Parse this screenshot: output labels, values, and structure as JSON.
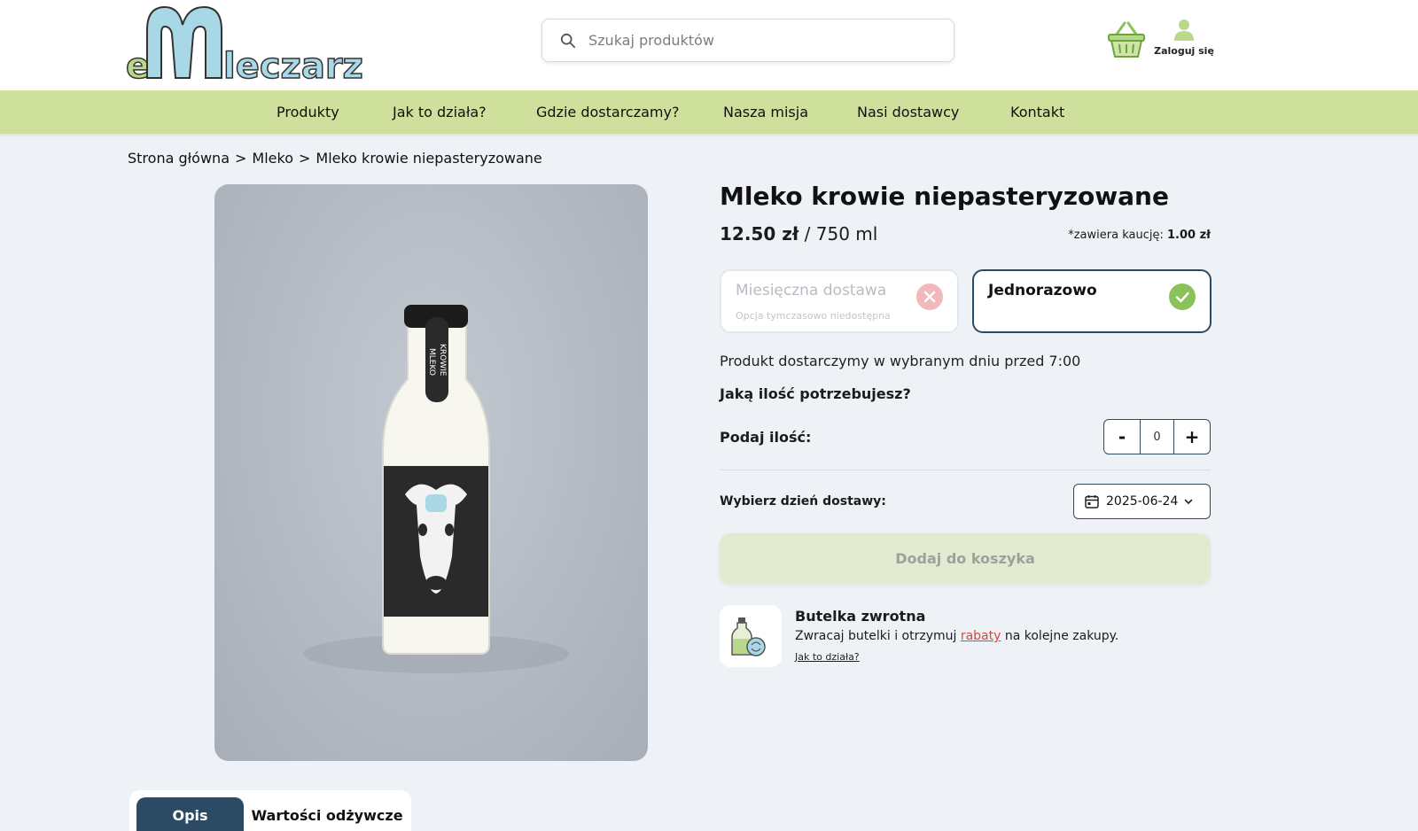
{
  "brand": {
    "logo_text": "eMleczarz"
  },
  "search": {
    "placeholder": "Szukaj produktów"
  },
  "header": {
    "login_label": "Zaloguj się"
  },
  "nav": {
    "items": [
      "Produkty",
      "Jak to działa?",
      "Gdzie dostarczamy?",
      "Nasza misja",
      "Nasi dostawcy",
      "Kontakt"
    ]
  },
  "breadcrumb": {
    "items": [
      "Strona główna",
      "Mleko",
      "Mleko krowie niepasteryzowane"
    ],
    "separator": ">"
  },
  "product": {
    "title": "Mleko krowie niepasteryzowane",
    "price": "12.50 zł",
    "unit": "/ 750 ml",
    "deposit_label": "*zawiera kaucję:",
    "deposit_value": "1.00 zł",
    "label_text_left": "MLEKO",
    "label_text_right": "KROWIE"
  },
  "options": {
    "monthly": {
      "title": "Miesięczna dostawa",
      "subtitle": "Opcja tymczasowo niedostępna",
      "state": "disabled"
    },
    "once": {
      "title": "Jednorazowo",
      "state": "selected"
    }
  },
  "delivery_note": "Produkt dostarczymy w wybranym dniu przed 7:00",
  "quantity": {
    "question": "Jaką ilość potrzebujesz?",
    "label": "Podaj ilość:",
    "minus": "-",
    "plus": "+",
    "value": "0"
  },
  "delivery_date": {
    "label": "Wybierz dzień dostawy:",
    "value": "2025-06-24"
  },
  "add_to_cart": "Dodaj do koszyka",
  "returnable": {
    "title": "Butelka zwrotna",
    "desc_before": "Zwracaj butelki i otrzymuj ",
    "desc_link": "rabaty",
    "desc_after": " na kolejne zakupy.",
    "how_link": "Jak to działa?"
  },
  "tabs": {
    "items": [
      "Opis",
      "Wartości odżywcze"
    ],
    "active_index": 0
  },
  "colors": {
    "nav_bg": "#cfe09c",
    "accent_dark": "#2d4a64",
    "success": "#8ac25a",
    "error": "#f2b9bd",
    "link_red": "#d24a3c",
    "page_bg": "#eef2f7"
  }
}
